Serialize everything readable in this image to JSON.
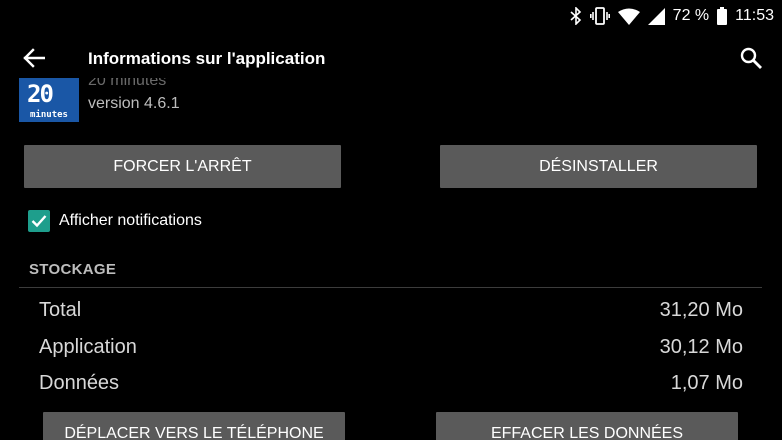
{
  "status_bar": {
    "battery": "72 %",
    "time": "11:53",
    "icons": [
      "bluetooth-icon",
      "vibrate-icon",
      "wifi-icon",
      "signal-icon",
      "battery-icon"
    ]
  },
  "app_bar": {
    "title": "Informations sur l'application",
    "back_icon": "arrow-left-icon",
    "search_icon": "search-icon"
  },
  "app": {
    "name": "20 minutes",
    "version": "version 4.6.1",
    "icon_text_top": "20",
    "icon_text_bottom": "minutes",
    "icon_color": "#1a57a6"
  },
  "buttons": {
    "force_stop": "FORCER L'ARRÊT",
    "uninstall": "DÉSINSTALLER",
    "move_to_phone": "DÉPLACER VERS LE TÉLÉPHONE",
    "clear_data": "EFFACER LES DONNÉES"
  },
  "notifications": {
    "label": "Afficher notifications",
    "checked": true,
    "accent": "#1e9e8c"
  },
  "storage": {
    "header": "STOCKAGE",
    "rows": [
      {
        "label": "Total",
        "value": "31,20 Mo"
      },
      {
        "label": "Application",
        "value": "30,12 Mo"
      },
      {
        "label": "Données",
        "value": "1,07 Mo"
      }
    ]
  }
}
